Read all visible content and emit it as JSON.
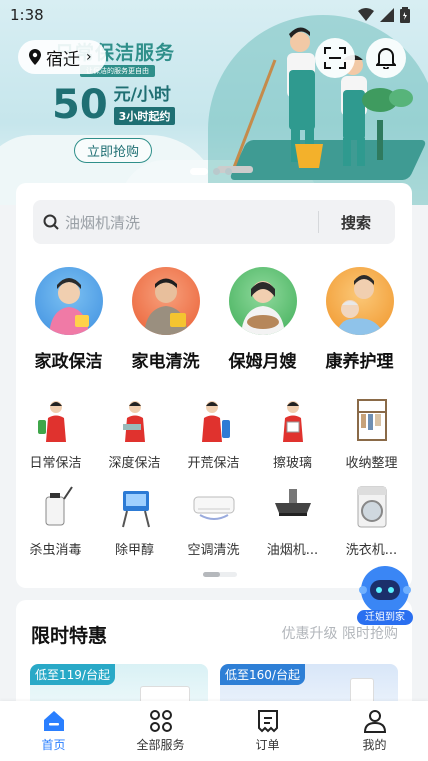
{
  "status_bar": {
    "time": "1:38"
  },
  "banner": {
    "title": "日常保洁服务",
    "tag": "让保洁的服务更自由",
    "price_number": "50",
    "price_unit": "元/小时",
    "price_sub": "3小时起约",
    "cta": "立即抢购",
    "active_slide_index": 0,
    "slide_count": 3
  },
  "header": {
    "location": "宿迁",
    "scan_icon": "scan-icon",
    "bell_icon": "bell-icon"
  },
  "search": {
    "placeholder": "油烟机清洗",
    "button": "搜索"
  },
  "main_categories": [
    {
      "label": "家政保洁",
      "bg": "#4aa0e8"
    },
    {
      "label": "家电清洗",
      "bg": "#f06a3c"
    },
    {
      "label": "保姆月嫂",
      "bg": "#4fbf68"
    },
    {
      "label": "康养护理",
      "bg": "#f5a133"
    }
  ],
  "sub_categories": [
    {
      "label": "日常保洁"
    },
    {
      "label": "深度保洁"
    },
    {
      "label": "开荒保洁"
    },
    {
      "label": "擦玻璃"
    },
    {
      "label": "收纳整理"
    },
    {
      "label": "杀虫消毒"
    },
    {
      "label": "除甲醇"
    },
    {
      "label": "空调清洗"
    },
    {
      "label": "油烟机..."
    },
    {
      "label": "洗衣机..."
    }
  ],
  "assistant": {
    "label": "迁姐到家"
  },
  "promo": {
    "title": "限时特惠",
    "subtitle": "优惠升级 限时抢购",
    "tiles": [
      {
        "price": "低至119/台起",
        "accent": "#29a9c7"
      },
      {
        "price": "低至160/台起",
        "accent": "#2e7fd6"
      }
    ]
  },
  "tabbar": {
    "items": [
      {
        "label": "首页",
        "active": true
      },
      {
        "label": "全部服务",
        "active": false
      },
      {
        "label": "订单",
        "active": false
      },
      {
        "label": "我的",
        "active": false
      }
    ]
  }
}
